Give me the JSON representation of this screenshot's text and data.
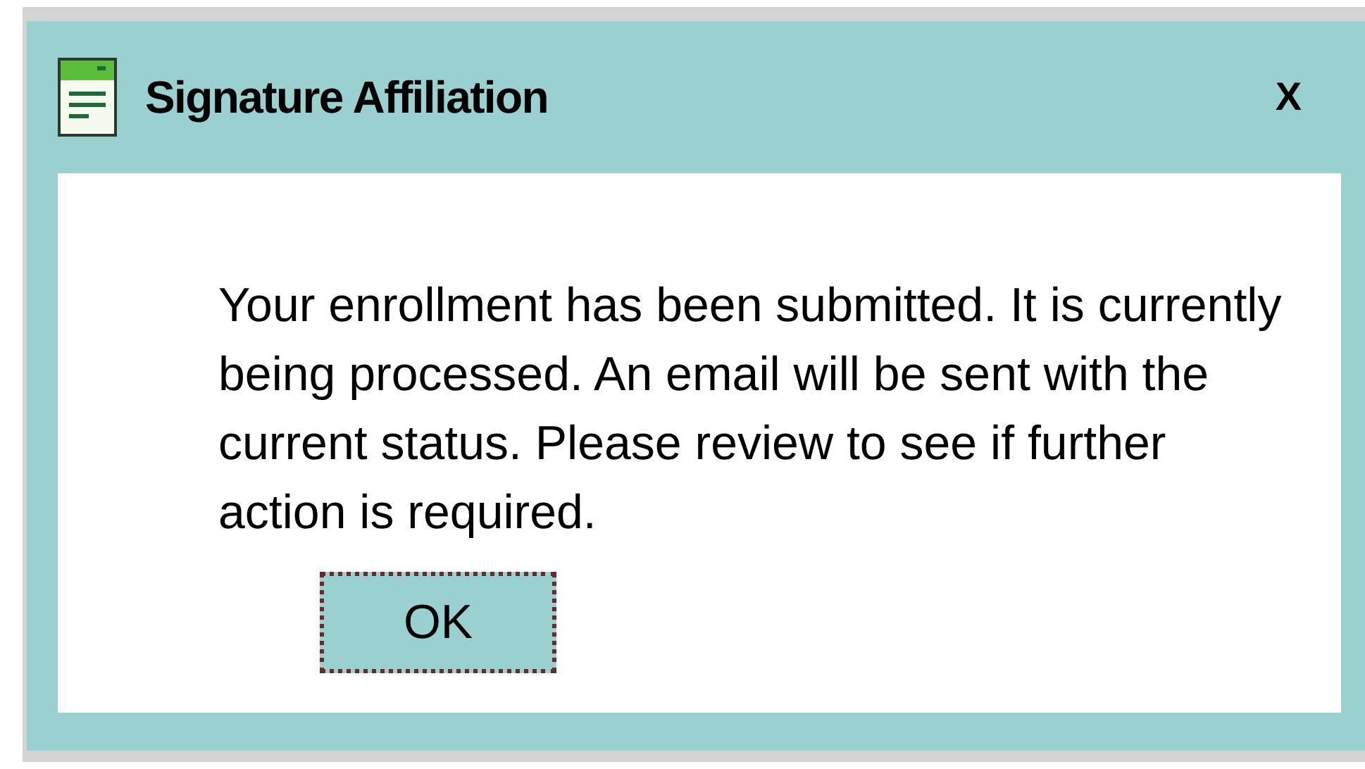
{
  "window": {
    "title": "Signature Affiliation",
    "close": "X"
  },
  "message": "Your enrollment has been submitted. It is currently being processed. An email will be sent with the current status. Please review to see if further action is required.",
  "buttons": [
    {
      "label": "OK",
      "focused": true
    }
  ]
}
